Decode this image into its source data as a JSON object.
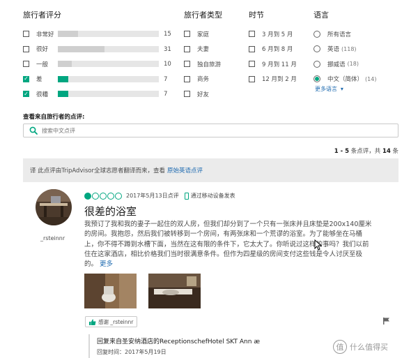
{
  "filters": {
    "traveler_rating": {
      "title": "旅行者评分",
      "items": [
        {
          "label": "非常好",
          "count": "15",
          "fill": 0.2,
          "color": "#cfcfcf",
          "checked": false
        },
        {
          "label": "很好",
          "count": "31",
          "fill": 0.46,
          "color": "#cfcfcf",
          "checked": false
        },
        {
          "label": "一般",
          "count": "10",
          "fill": 0.14,
          "color": "#cfcfcf",
          "checked": false
        },
        {
          "label": "差",
          "count": "7",
          "fill": 0.1,
          "color": "#00a680",
          "checked": true
        },
        {
          "label": "很糟",
          "count": "7",
          "fill": 0.1,
          "color": "#00a680",
          "checked": true
        }
      ]
    },
    "traveler_type": {
      "title": "旅行者类型",
      "items": [
        {
          "label": "家庭"
        },
        {
          "label": "夫妻"
        },
        {
          "label": "独自旅游"
        },
        {
          "label": "商务"
        },
        {
          "label": "好友"
        }
      ]
    },
    "season": {
      "title": "时节",
      "items": [
        {
          "label": "3 月到 5 月"
        },
        {
          "label": "6 月到 8 月"
        },
        {
          "label": "9 月到 11 月"
        },
        {
          "label": "12 月到 2 月"
        }
      ]
    },
    "language": {
      "title": "语言",
      "items": [
        {
          "label": "所有语言",
          "count": "",
          "checked": false
        },
        {
          "label": "英语",
          "count": "(118)",
          "checked": false
        },
        {
          "label": "挪威语",
          "count": "(18)",
          "checked": false
        },
        {
          "label": "中文（简体）",
          "count": "(14)",
          "checked": true
        }
      ],
      "more_label": "更多语言"
    }
  },
  "search": {
    "title": "查看来自旅行者的点评:",
    "placeholder": "搜索中文点评"
  },
  "paging": {
    "range": "1 - 5",
    "text_mid": "条点评，共",
    "total": "14",
    "unit": "条"
  },
  "notice": {
    "text": "译 此点评由TripAdvisor全球志愿者翻译而来，查看",
    "link": "原始英语点评"
  },
  "review": {
    "username": "_rsteinnr",
    "rating": 1,
    "rating_max": 5,
    "date": "2017年5月13日点评",
    "via_mobile": "通过移动设备发表",
    "title": "很差的浴室",
    "body": "我预订了我和我的妻子一起住的双人房，但我们却分到了一个只有一张床并且床垫是200x140厘米的房间。我抱怨，然后我们被转移到一个房间，有两张床和一个荒谬的浴室。为了能够坐在马桶上，你不得不蹲到水槽下面，当然在这有限的条件下，它太大了。你听说过这样的事吗？我们以前住在这家酒店，相比价格我们当时很满意条件。但作为四星级的房间支付这些钱是令人讨厌至极的。",
    "more_label": "更多",
    "thanks_label": "感谢 _rsteinnr"
  },
  "reply": {
    "title": "回复来自圣安纳酒店的ReceptionschefHotel SKT Ann æ",
    "date": "回复时间：2017年5月19日"
  },
  "watermark": {
    "badge": "值",
    "text": "什么值得买"
  }
}
